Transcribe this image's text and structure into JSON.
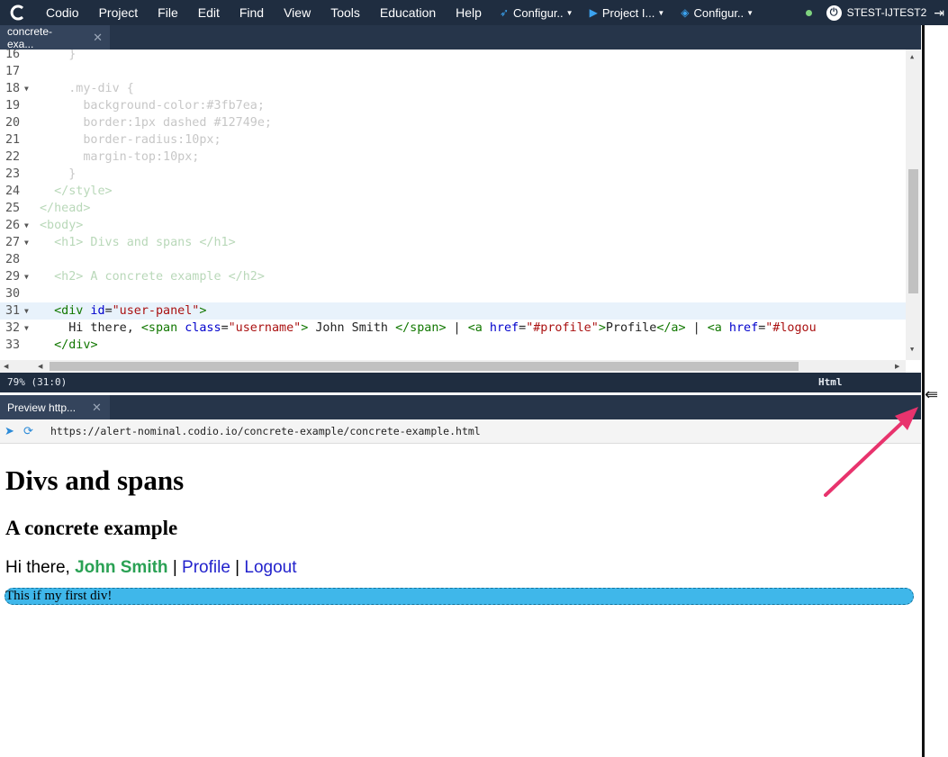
{
  "menubar": {
    "app_name": "Codio",
    "items": [
      "Project",
      "File",
      "Edit",
      "Find",
      "View",
      "Tools",
      "Education",
      "Help"
    ],
    "dropdowns": [
      {
        "label": "Configur..",
        "icon": "rocket-icon"
      },
      {
        "label": "Project I...",
        "icon": "play-icon"
      },
      {
        "label": "Configur..",
        "icon": "diamond-icon"
      }
    ],
    "user": "STEST-IJTEST2"
  },
  "editor": {
    "tab_label": "concrete-exa...",
    "lines": [
      {
        "n": "16",
        "fold": false,
        "html": "    }"
      },
      {
        "n": "17",
        "fold": false,
        "html": ""
      },
      {
        "n": "18",
        "fold": true,
        "html": "    .my-div {"
      },
      {
        "n": "19",
        "fold": false,
        "html": "      background-color:#3fb7ea;"
      },
      {
        "n": "20",
        "fold": false,
        "html": "      border:1px dashed #12749e;"
      },
      {
        "n": "21",
        "fold": false,
        "html": "      border-radius:10px;"
      },
      {
        "n": "22",
        "fold": false,
        "html": "      margin-top:10px;"
      },
      {
        "n": "23",
        "fold": false,
        "html": "    }"
      },
      {
        "n": "24",
        "fold": false,
        "html": "  </style>"
      },
      {
        "n": "25",
        "fold": false,
        "html": "</head>"
      },
      {
        "n": "26",
        "fold": true,
        "html": "<body>"
      },
      {
        "n": "27",
        "fold": true,
        "html": "  <h1> Divs and spans </h1>"
      },
      {
        "n": "28",
        "fold": false,
        "html": ""
      },
      {
        "n": "29",
        "fold": true,
        "html": "  <h2> A concrete example </h2>"
      },
      {
        "n": "30",
        "fold": false,
        "html": ""
      },
      {
        "n": "31",
        "fold": true,
        "html": "  <div id=\"user-panel\">"
      },
      {
        "n": "32",
        "fold": true,
        "html": "    Hi there, <span class=\"username\"> John Smith </span> | <a href=\"#profile\">Profile</a> | <a href=\"#logou"
      },
      {
        "n": "33",
        "fold": false,
        "html": "  </div>"
      }
    ],
    "status_left": "79%  (31:0)",
    "status_mode": "Html"
  },
  "preview": {
    "tab_label": "Preview http...",
    "url": "https://alert-nominal.codio.io/concrete-example/concrete-example.html",
    "h1": "Divs and spans",
    "h2": "A concrete example",
    "greeting": "Hi there, ",
    "username": "John Smith",
    "sep1": " | ",
    "profile_link": "Profile",
    "sep2": " | ",
    "logout_link": "Logout",
    "div_text": "This if my first div!"
  },
  "colors": {
    "menubar_bg": "#1f2d40",
    "div_bg": "#3fb7ea",
    "div_border": "#12749e",
    "username_color": "#2aa154",
    "arrow_color": "#e8336d"
  }
}
